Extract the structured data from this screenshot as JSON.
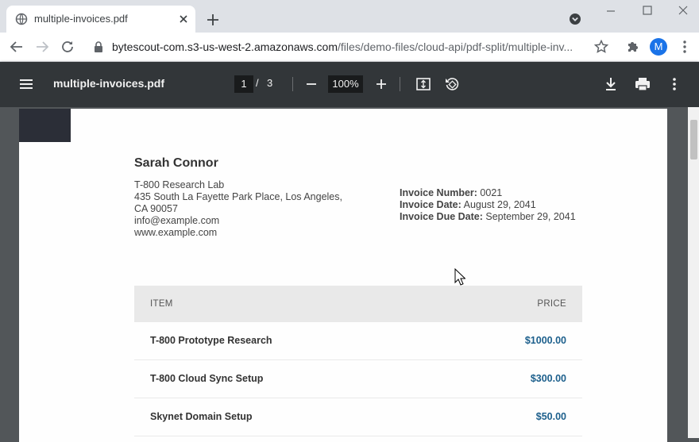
{
  "colors": {
    "tab_strip_bg": "#dee1e6",
    "pdf_toolbar_bg": "#323639",
    "viewer_bg": "#525659",
    "price_text": "#1c5f8c",
    "profile_avatar": "#1a73e8"
  },
  "browser": {
    "tab": {
      "title": "multiple-invoices.pdf",
      "icon": "globe-icon"
    },
    "address": {
      "host": "bytescout-com.s3-us-west-2.amazonaws.com",
      "path": "/files/demo-files/cloud-api/pdf-split/multiple-inv..."
    },
    "profile_initial": "M"
  },
  "pdf_toolbar": {
    "title": "multiple-invoices.pdf",
    "current_page": "1",
    "page_separator": "/",
    "total_pages": "3",
    "zoom": "100%"
  },
  "invoice": {
    "customer_name": "Sarah Connor",
    "address_lines": [
      "T-800 Research Lab",
      "435 South La Fayette Park Place, Los Angeles,",
      "CA 90057",
      "info@example.com",
      "www.example.com"
    ],
    "meta": [
      {
        "label": "Invoice Number:",
        "value": "0021"
      },
      {
        "label": "Invoice Date:",
        "value": "August 29, 2041"
      },
      {
        "label": "Invoice Due Date:",
        "value": "September 29, 2041"
      }
    ],
    "table": {
      "headers": {
        "item": "ITEM",
        "price": "PRICE"
      },
      "rows": [
        {
          "item": "T-800 Prototype Research",
          "price": "$1000.00"
        },
        {
          "item": "T-800 Cloud Sync Setup",
          "price": "$300.00"
        },
        {
          "item": "Skynet Domain Setup",
          "price": "$50.00"
        }
      ]
    }
  }
}
